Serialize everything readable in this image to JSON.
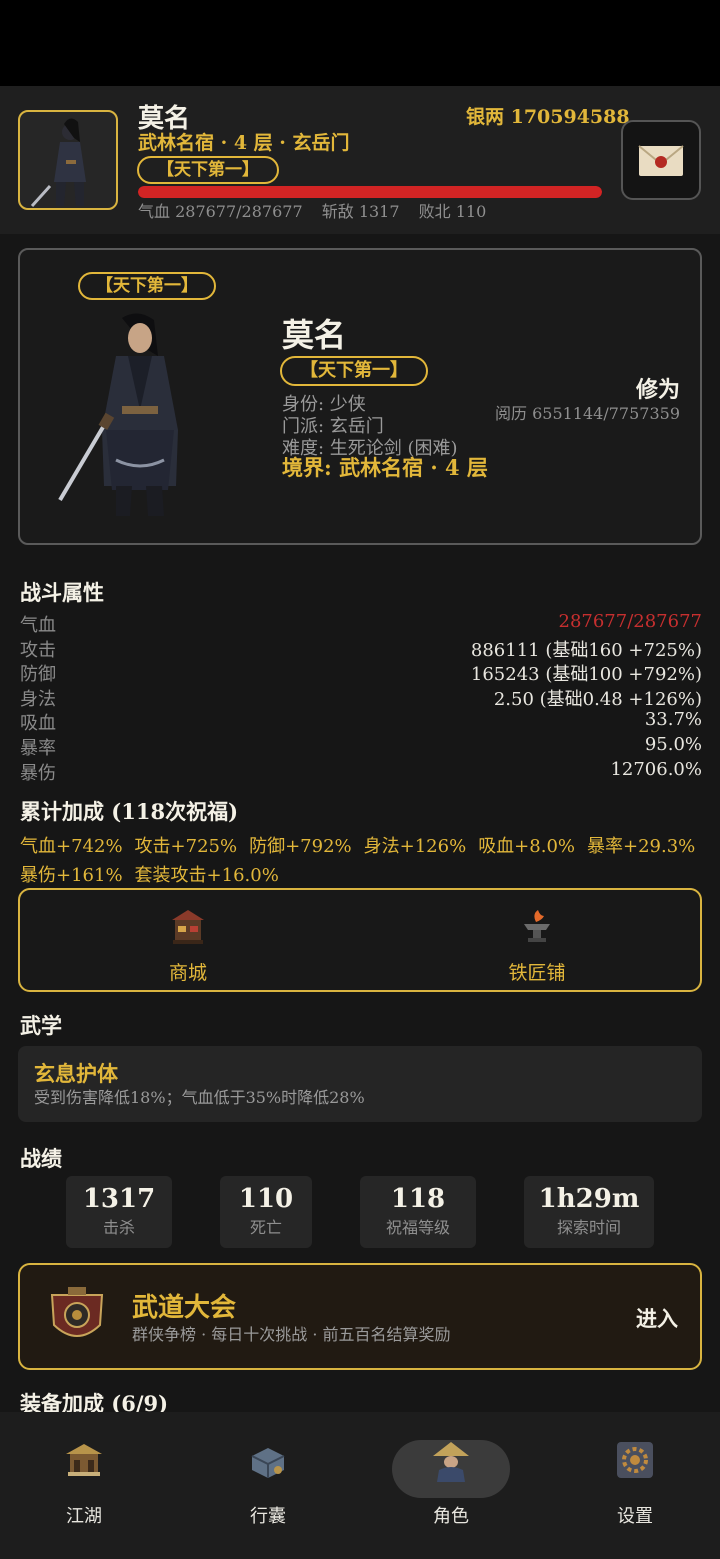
{
  "header": {
    "name": "莫名",
    "silver": "银两 170594588",
    "realm_line": "武林名宿 · 4 层 · 玄岳门",
    "title_badge": "【天下第一】",
    "hp_fraction": 1.0,
    "stats": {
      "hp": "气血 287677/287677",
      "kills": "斩敌 1317",
      "defeats": "败北 110"
    },
    "mail_icon": "mail-envelope-icon"
  },
  "profile": {
    "title_badge": "【天下第一】",
    "name": "莫名",
    "title_badge2": "【天下第一】",
    "identity": "身份: 少侠",
    "sect": "门派: 玄岳门",
    "difficulty": "难度: 生死论剑 (困难)",
    "realm": "境界: 武林名宿 · 4 层",
    "cultivation_label": "修为",
    "experience": "阅历 6551144/7757359"
  },
  "combat": {
    "title": "战斗属性",
    "rows": [
      {
        "label": "气血",
        "value": "287677/287677",
        "color": "#c62f2f"
      },
      {
        "label": "攻击",
        "value": "886111 (基础160 +725%)"
      },
      {
        "label": "防御",
        "value": "165243 (基础100 +792%)"
      },
      {
        "label": "身法",
        "value": "2.50 (基础0.48 +126%)"
      },
      {
        "label": "吸血",
        "value": "33.7%"
      },
      {
        "label": "暴率",
        "value": "95.0%"
      },
      {
        "label": "暴伤",
        "value": "12706.0%"
      }
    ]
  },
  "bonus": {
    "title": "累计加成 (118次祝福)",
    "line1": [
      "气血+742%",
      "攻击+725%",
      "防御+792%",
      "身法+126%",
      "吸血+8.0%",
      "暴率+29.3%"
    ],
    "line2": [
      "暴伤+161%",
      "套装攻击+16.0%"
    ]
  },
  "shops": {
    "mall": "商城",
    "smith": "铁匠铺"
  },
  "martial": {
    "title": "武学",
    "skill_name": "玄息护体",
    "skill_desc": "受到伤害降低18%；气血低于35%时降低28%"
  },
  "record": {
    "title": "战绩",
    "items": [
      {
        "value": "1317",
        "caption": "击杀"
      },
      {
        "value": "110",
        "caption": "死亡"
      },
      {
        "value": "118",
        "caption": "祝福等级"
      },
      {
        "value": "1h29m",
        "caption": "探索时间"
      }
    ]
  },
  "tournament": {
    "name": "武道大会",
    "desc": "群侠争榜 · 每日十次挑战 · 前五百名结算奖励",
    "enter": "进入"
  },
  "equipment": {
    "title": "装备加成 (6/9)"
  },
  "nav": {
    "items": [
      {
        "label": "江湖",
        "icon": "jianghu-pavilion-icon"
      },
      {
        "label": "行囊",
        "icon": "bag-icon"
      },
      {
        "label": "角色",
        "icon": "character-straw-hat-icon",
        "active": true
      },
      {
        "label": "设置",
        "icon": "settings-gear-icon"
      }
    ]
  },
  "colors": {
    "accent_gold": "#e2b73a",
    "hp_red": "#d22424",
    "background": "#161616"
  }
}
